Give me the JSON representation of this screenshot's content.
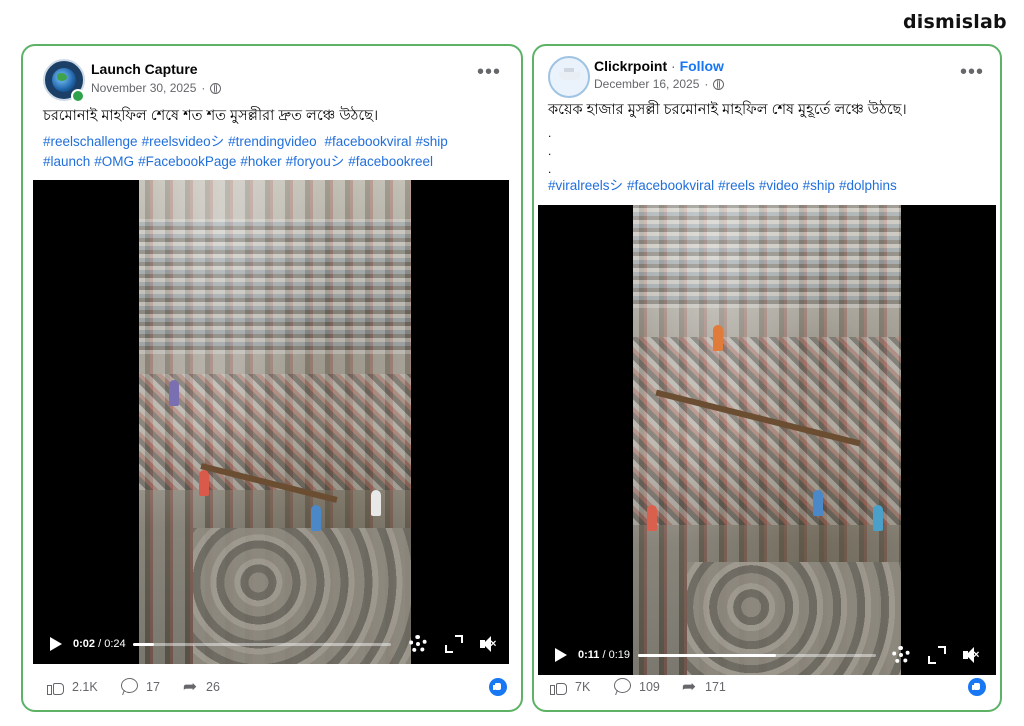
{
  "brand": "dismislab",
  "posts": [
    {
      "page_name": "Launch Capture",
      "follow_label": "",
      "date": "November 30, 2025",
      "caption": "চরমোনাই মাহফিল শেষে শত শত মুসল্লীরা দ্রুত লঞ্চে উঠছে।",
      "hashtags_line1": [
        "#reelschallenge",
        "#reelsvideoシ",
        "#trendingvideo",
        "#facebookviral",
        "#ship"
      ],
      "hashtags_line2": [
        "#launch",
        "#OMG",
        "#FacebookPage",
        "#hoker",
        "#foryouシ",
        "#facebookreel"
      ],
      "video": {
        "current_time": "0:02",
        "duration": "/ 0:24",
        "progress": 0.083
      },
      "stats": {
        "likes": "2.1K",
        "comments": "17",
        "shares": "26"
      },
      "online": true
    },
    {
      "page_name": "Clickrpoint",
      "follow_label": "Follow",
      "date": "December 16, 2025",
      "caption": "কয়েক হাজার মুসল্লী চরমোনাই মাহফিল শেষ মুহূর্তে লঞ্চে উঠছে।",
      "caption_dots": [
        ".",
        ".",
        "."
      ],
      "hashtags_line1": [
        "#viralreelsシ",
        "#facebookviral",
        "#reels",
        "#video",
        "#ship",
        "#dolphins"
      ],
      "video": {
        "current_time": "0:11",
        "duration": "/ 0:19",
        "progress": 0.58
      },
      "stats": {
        "likes": "7K",
        "comments": "109",
        "shares": "171"
      }
    }
  ],
  "colors": {
    "border": "#5db266",
    "link": "#216fdb",
    "accent": "#1877f2"
  },
  "icons": [
    "play-icon",
    "settings-gear-icon",
    "fullscreen-icon",
    "mute-icon",
    "like-icon",
    "comment-icon",
    "share-icon",
    "globe-icon",
    "more-options-icon",
    "reaction-like-icon"
  ]
}
